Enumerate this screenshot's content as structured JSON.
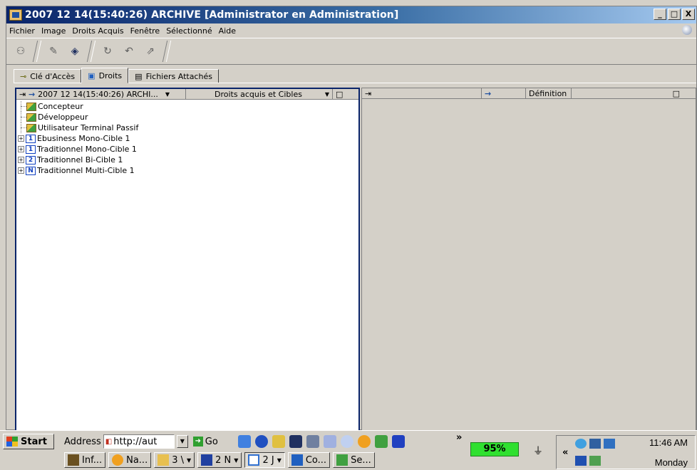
{
  "window": {
    "title": "2007 12 14(15:40:26) ARCHIVE [Administrator en Administration]",
    "controls": [
      "_",
      "□",
      "X"
    ]
  },
  "menu": [
    "Fichier",
    "Image",
    "Droits Acquis",
    "Fenêtre",
    "Sélectionné",
    "Aide"
  ],
  "tabs": [
    {
      "label": "Clé d'Accès",
      "icon": "key-icon"
    },
    {
      "label": "Droits",
      "icon": "rights-icon"
    },
    {
      "label": "Fichiers Attachés",
      "icon": "document-icon"
    }
  ],
  "left_pane": {
    "header": {
      "col1_arrow": "⇥",
      "col1_source": "2007 12 14(15:40:26) ARCHI...",
      "col2": "Droits acquis et Cibles"
    },
    "tree": [
      {
        "label": "Concepteur",
        "type": "role",
        "expandable": false
      },
      {
        "label": "Développeur",
        "type": "role",
        "expandable": false
      },
      {
        "label": "Utilisateur Terminal Passif",
        "type": "role",
        "expandable": false
      },
      {
        "label": "Ebusiness Mono-Cible 1",
        "type": "target",
        "badge": "1",
        "expandable": true
      },
      {
        "label": "Traditionnel Mono-Cible 1",
        "type": "target",
        "badge": "1",
        "expandable": true
      },
      {
        "label": "Traditionnel Bi-Cible 1",
        "type": "target",
        "badge": "2",
        "expandable": true
      },
      {
        "label": "Traditionnel Multi-Cible 1",
        "type": "target",
        "badge": "N",
        "expandable": true
      }
    ]
  },
  "right_pane": {
    "header": {
      "col3": "Définition"
    }
  },
  "taskbar": {
    "start": "Start",
    "address_label": "Address",
    "address_value": "http://aut",
    "go": "Go",
    "battery": "95%",
    "time": "11:46 AM",
    "day": "Monday",
    "tasks": [
      {
        "label": "Inf...",
        "color": "#6a5020"
      },
      {
        "label": "Na...",
        "color": "#f0a020"
      },
      {
        "label": "3 \\",
        "color": "#e8c050"
      },
      {
        "label": "2 N",
        "color": "#2040a0"
      },
      {
        "label": "2 J",
        "color": "#3070d0"
      },
      {
        "label": "Co...",
        "color": "#2060c0"
      },
      {
        "label": "Se...",
        "color": "#40a040"
      }
    ]
  }
}
